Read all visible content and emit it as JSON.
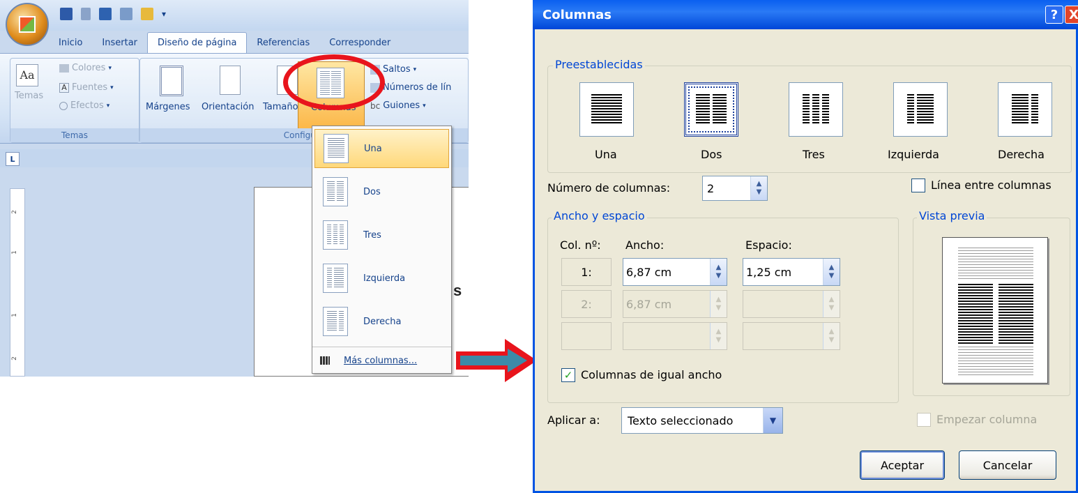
{
  "word": {
    "tabs": [
      "Inicio",
      "Insertar",
      "Diseño de página",
      "Referencias",
      "Corresponder"
    ],
    "temas_group": {
      "temas_label": "Temas",
      "colores": "Colores",
      "fuentes": "Fuentes",
      "efectos": "Efectos",
      "group_label": "Temas"
    },
    "config_group": {
      "margenes": "Márgenes",
      "orientacion": "Orientación",
      "tamano": "Tamaño",
      "columnas": "Columnas",
      "saltos": "Saltos",
      "numeros_linea": "Números de lín",
      "guiones": "Guiones",
      "group_label": "Configura"
    },
    "page_fragment": "s",
    "ruler_numbers": [
      "2",
      "1",
      "1",
      "2"
    ]
  },
  "columns_menu": {
    "items": [
      "Una",
      "Dos",
      "Tres",
      "Izquierda",
      "Derecha"
    ],
    "more": "Más columnas..."
  },
  "dialog": {
    "title": "Columnas",
    "help": "?",
    "close": "X",
    "presets_legend": "Preestablecidas",
    "presets": [
      "Una",
      "Dos",
      "Tres",
      "Izquierda",
      "Derecha"
    ],
    "num_columns_label": "Número de columnas:",
    "num_columns_value": "2",
    "line_between_label": "Línea entre columnas",
    "width_spacing_legend": "Ancho y espacio",
    "col_header": "Col. nº:",
    "width_header": "Ancho:",
    "spacing_header": "Espacio:",
    "rows": [
      {
        "num": "1:",
        "width": "6,87 cm",
        "spacing": "1,25 cm"
      },
      {
        "num": "2:",
        "width": "6,87 cm",
        "spacing": ""
      },
      {
        "num": "",
        "width": "",
        "spacing": ""
      }
    ],
    "preview_legend": "Vista previa",
    "equal_width_label": "Columnas de igual ancho",
    "equal_width_check": "✓",
    "apply_label": "Aplicar a:",
    "apply_value": "Texto seleccionado",
    "start_column_label": "Empezar columna",
    "ok": "Aceptar",
    "cancel": "Cancelar"
  },
  "colors": {
    "accent_red": "#e8141c",
    "title_blue": "#0a5ff0",
    "ribbon_blue": "#15428b"
  }
}
